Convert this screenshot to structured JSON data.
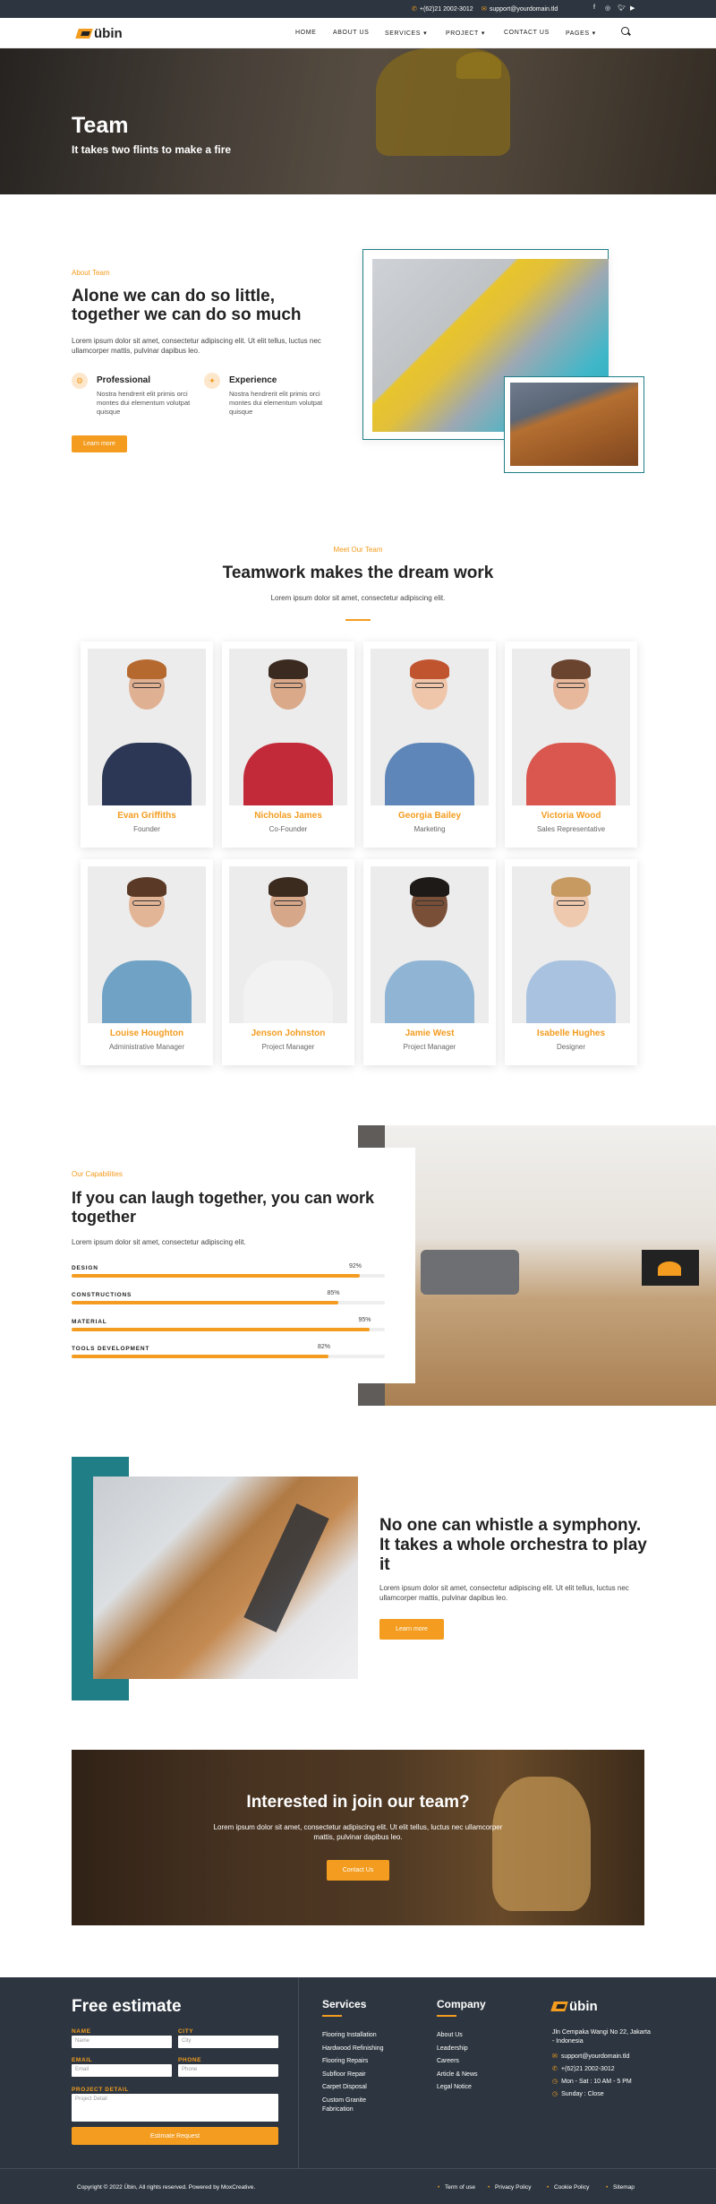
{
  "topbar": {
    "phone": "+(62)21 2002-3012",
    "email": "support@yourdomain.tld",
    "social": [
      "facebook-icon",
      "instagram-icon",
      "twitter-icon",
      "youtube-icon"
    ]
  },
  "nav": {
    "logo": "übin",
    "items": [
      {
        "label": "HOME",
        "dropdown": false
      },
      {
        "label": "ABOUT US",
        "dropdown": false
      },
      {
        "label": "SERVICES",
        "dropdown": true
      },
      {
        "label": "PROJECT",
        "dropdown": true
      },
      {
        "label": "CONTACT US",
        "dropdown": false
      },
      {
        "label": "PAGES",
        "dropdown": true
      }
    ]
  },
  "hero": {
    "title": "Team",
    "subtitle": "It takes two flints to make a fire"
  },
  "about": {
    "eyebrow": "About Team",
    "heading": "Alone we can do so little, together we can do so much",
    "text": "Lorem ipsum dolor sit amet, consectetur adipiscing elit. Ut elit tellus, luctus nec ullamcorper mattis, pulvinar dapibus leo.",
    "features": [
      {
        "title": "Professional",
        "text": "Nostra hendrerit elit primis orci montes dui elementum volutpat quisque"
      },
      {
        "title": "Experience",
        "text": "Nostra hendrerit elit primis orci montes dui elementum volutpat quisque"
      }
    ],
    "button": "Learn more"
  },
  "team": {
    "eyebrow": "Meet Our Team",
    "heading": "Teamwork makes the dream work",
    "text": "Lorem ipsum dolor sit amet, consectetur adipiscing elit.",
    "members": [
      {
        "name": "Evan Griffiths",
        "role": "Founder"
      },
      {
        "name": "Nicholas James",
        "role": "Co-Founder"
      },
      {
        "name": "Georgia Bailey",
        "role": "Marketing"
      },
      {
        "name": "Victoria Wood",
        "role": "Sales Representative"
      },
      {
        "name": "Louise Houghton",
        "role": "Administrative Manager"
      },
      {
        "name": "Jenson Johnston",
        "role": "Project Manager"
      },
      {
        "name": "Jamie West",
        "role": "Project Manager"
      },
      {
        "name": "Isabelle Hughes",
        "role": "Designer"
      }
    ]
  },
  "capabilities": {
    "eyebrow": "Our Capabilities",
    "heading": "If you can laugh together, you can work together",
    "text": "Lorem ipsum dolor sit amet, consectetur adipiscing elit.",
    "bars": [
      {
        "label": "DESIGN",
        "percent": 92,
        "percent_label": "92%"
      },
      {
        "label": "CONSTRUCTIONS",
        "percent": 85,
        "percent_label": "85%"
      },
      {
        "label": "MATERIAL",
        "percent": 95,
        "percent_label": "95%"
      },
      {
        "label": "TOOLS DEVELOPMENT",
        "percent": 82,
        "percent_label": "82%"
      }
    ]
  },
  "orchestra": {
    "heading": "No one can whistle a symphony. It takes a whole orchestra to play it",
    "text": "Lorem ipsum dolor sit amet, consectetur adipiscing elit. Ut elit tellus, luctus nec ullamcorper mattis, pulvinar dapibus leo.",
    "button": "Learn more"
  },
  "join": {
    "heading": "Interested in join our team?",
    "text": "Lorem ipsum dolor sit amet, consectetur adipiscing elit. Ut elit tellus, luctus nec ullamcorper mattis, pulvinar dapibus leo.",
    "button": "Contact Us"
  },
  "footer": {
    "estimate": {
      "title": "Free estimate",
      "name_label": "NAME",
      "name_placeholder": "Name",
      "city_label": "CITY",
      "city_placeholder": "City",
      "email_label": "EMAIL",
      "email_placeholder": "Email",
      "phone_label": "PHONE",
      "phone_placeholder": "Phone",
      "detail_label": "PROJECT DETAIL",
      "detail_placeholder": "Project Detail",
      "submit": "Estimate Request"
    },
    "services": {
      "title": "Services",
      "links": [
        "Flooring Installation",
        "Hardwood Refinishing",
        "Flooring Repairs",
        "Subfloor Repair",
        "Carpet Disposal",
        "Custom Granite Fabrication"
      ]
    },
    "company": {
      "title": "Company",
      "links": [
        "About Us",
        "Leadership",
        "Careers",
        "Article & News",
        "Legal Notice"
      ]
    },
    "contact": {
      "logo": "übin",
      "address": "Jln Cempaka Wangi No 22, Jakarta - Indonesia",
      "email": "support@yourdomain.tld",
      "phone": "+(62)21 2002-3012",
      "hours": "Mon - Sat : 10 AM - 5 PM",
      "closed": "Sunday : Close"
    },
    "copyright": "Copyright © 2022 Übin, All rights reserved. Powered by MoxCreative.",
    "bottom_links": [
      "Term of use",
      "Privacy Policy",
      "Cookie Policy",
      "Sitemap"
    ]
  }
}
